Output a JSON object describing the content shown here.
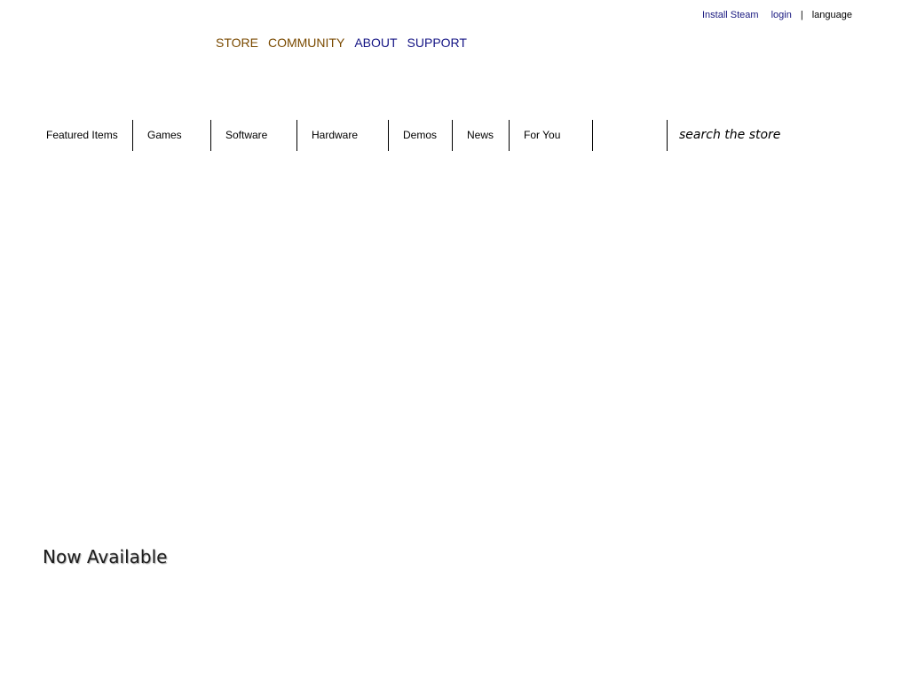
{
  "global_actions": {
    "install_steam": "Install Steam",
    "login": "login",
    "separator": "|",
    "language": "language"
  },
  "supernav": {
    "items": [
      {
        "label": "STORE"
      },
      {
        "label": "COMMUNITY"
      },
      {
        "label": "ABOUT"
      },
      {
        "label": "SUPPORT"
      }
    ]
  },
  "store_nav": {
    "tabs": [
      {
        "label": "Featured Items"
      },
      {
        "label": "Games"
      },
      {
        "label": "Software"
      },
      {
        "label": "Hardware"
      },
      {
        "label": "Demos"
      },
      {
        "label": "News"
      },
      {
        "label": "For You"
      }
    ],
    "search_placeholder": "search the store"
  },
  "sections": {
    "now_available": "Now Available"
  },
  "colors": {
    "link_visited": "#7a4a00",
    "link_unvisited": "#141484",
    "account_link": "#1a1a80"
  }
}
